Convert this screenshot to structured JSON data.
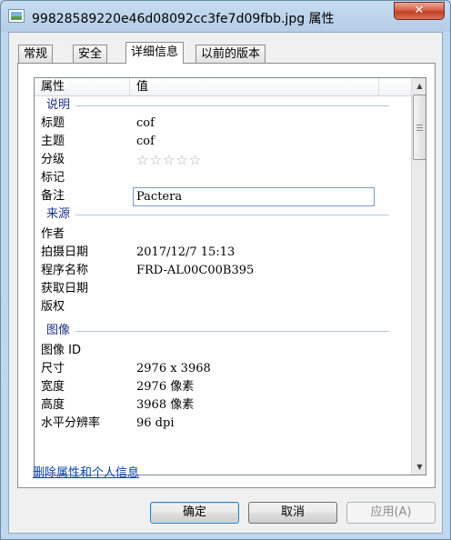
{
  "window": {
    "title": "99828589220e46d08092cc3fe7d09fbb.jpg 属性",
    "close_label": "✕"
  },
  "tabs": [
    {
      "label": "常规"
    },
    {
      "label": "安全"
    },
    {
      "label": "详细信息"
    },
    {
      "label": "以前的版本"
    }
  ],
  "list": {
    "col_name": "属性",
    "col_value": "值",
    "groups": {
      "description": "说明",
      "origin": "来源",
      "image": "图像"
    },
    "rows": {
      "title": {
        "name": "标题",
        "value": "cof"
      },
      "subject": {
        "name": "主题",
        "value": "cof"
      },
      "rating": {
        "name": "分级",
        "value": "☆☆☆☆☆"
      },
      "tags": {
        "name": "标记",
        "value": ""
      },
      "comments": {
        "name": "备注",
        "value": "Pactera"
      },
      "authors": {
        "name": "作者",
        "value": ""
      },
      "date_taken": {
        "name": "拍摄日期",
        "value": "2017/12/7 15:13"
      },
      "program_name": {
        "name": "程序名称",
        "value": "FRD-AL00C00B395"
      },
      "date_acquired": {
        "name": "获取日期",
        "value": ""
      },
      "copyright": {
        "name": "版权",
        "value": ""
      },
      "image_id": {
        "name": "图像 ID",
        "value": ""
      },
      "dimensions": {
        "name": "尺寸",
        "value": "2976 x 3968"
      },
      "width": {
        "name": "宽度",
        "value": "2976 像素"
      },
      "height": {
        "name": "高度",
        "value": "3968 像素"
      },
      "h_resolution": {
        "name": "水平分辨率",
        "value": "96 dpi"
      }
    }
  },
  "remove_link": "删除属性和个人信息",
  "buttons": {
    "ok": "确定",
    "cancel": "取消",
    "apply": "应用(A)"
  }
}
